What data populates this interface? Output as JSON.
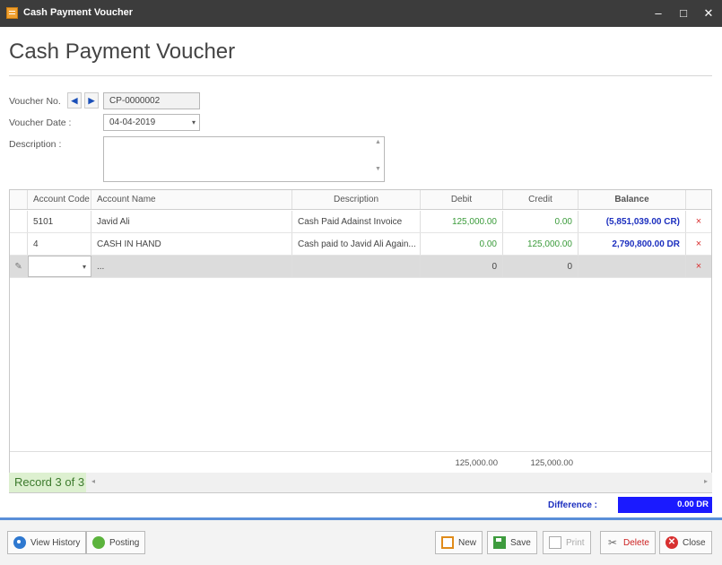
{
  "window": {
    "title": "Cash Payment Voucher",
    "controls": [
      "–",
      "□",
      "✕"
    ]
  },
  "page_title": "Cash Payment Voucher",
  "form": {
    "voucher_no_label": "Voucher No.",
    "voucher_no": "CP-0000002",
    "nav_first": "◀",
    "nav_last": "▶",
    "voucher_date_label": "Voucher Date :",
    "voucher_date": "04-04-2019",
    "description_label": "Description :",
    "description": ""
  },
  "grid": {
    "columns": [
      "Account Code",
      "Account Name",
      "Description",
      "Debit",
      "Credit",
      "Balance"
    ],
    "rows": [
      {
        "account_code": "5101",
        "account_name": "Javid Ali",
        "description": "Cash Paid Adainst Invoice",
        "debit": "125,000.00",
        "credit": "0.00",
        "balance": "(5,851,039.00 CR)"
      },
      {
        "account_code": "4",
        "account_name": "CASH IN HAND",
        "description": "Cash paid to Javid Ali Again...",
        "debit": "0.00",
        "credit": "125,000.00",
        "balance": "2,790,800.00 DR"
      }
    ],
    "new_row": {
      "account_name": "...",
      "debit": "0",
      "credit": "0"
    },
    "totals": {
      "debit": "125,000.00",
      "credit": "125,000.00"
    },
    "delete_symbol": "×",
    "edit_symbol": "✎"
  },
  "pager": {
    "record_text": "Record 3 of 3"
  },
  "difference": {
    "label": "Difference :",
    "value": "0.00 DR"
  },
  "toolbar": {
    "view_history": "View History",
    "posting": "Posting",
    "new": "New",
    "save": "Save",
    "print": "Print",
    "delete": "Delete",
    "close": "Close"
  }
}
